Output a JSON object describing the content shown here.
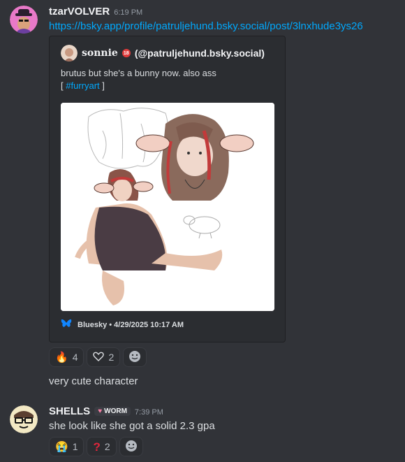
{
  "messages": [
    {
      "username": "tzarVOLVER",
      "timestamp": "6:19 PM",
      "link": "https://bsky.app/profile/patruljehund.bsky.social/post/3lnxhude3ys26",
      "embed": {
        "author_display": "sonnie",
        "author_badge": "18",
        "author_handle": "(@patruljehund.bsky.social)",
        "description_line1": "brutus but she's a bunny now. also ass",
        "tag_open": "[",
        "tag": "#furryart",
        "tag_close": "]",
        "footer": "Bluesky • 4/29/2025 10:17 AM"
      },
      "reactions": [
        {
          "emoji": "fire-emoji",
          "count": "4"
        },
        {
          "emoji": "heart-outline-emoji",
          "count": "2"
        }
      ],
      "followup": "very cute character"
    },
    {
      "username": "SHELLS",
      "role_badge": "WORM",
      "timestamp": "7:39 PM",
      "text": "she look like she got a solid 2.3 gpa",
      "reactions": [
        {
          "emoji": "crying-emoji",
          "count": "1"
        },
        {
          "emoji": "red-question-emoji",
          "count": "2"
        }
      ]
    }
  ],
  "colors": {
    "background": "#313338",
    "embed_bg": "#2b2d31",
    "link": "#00a8fc",
    "bluesky": "#1185fe"
  }
}
